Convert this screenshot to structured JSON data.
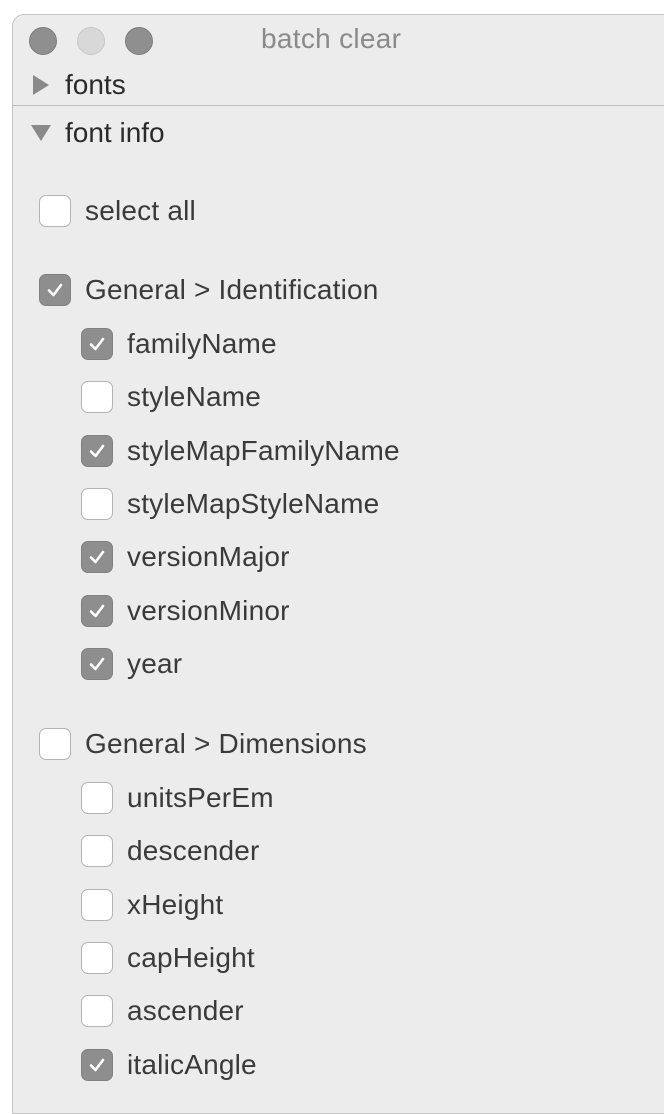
{
  "window": {
    "title": "batch clear"
  },
  "sections": {
    "fonts": {
      "label": "fonts",
      "expanded": false
    },
    "font_info": {
      "label": "font info",
      "expanded": true
    }
  },
  "select_all": {
    "label": "select all",
    "checked": false
  },
  "groups": [
    {
      "label": "General > Identification",
      "checked": true,
      "items": [
        {
          "label": "familyName",
          "checked": true
        },
        {
          "label": "styleName",
          "checked": false
        },
        {
          "label": "styleMapFamilyName",
          "checked": true
        },
        {
          "label": "styleMapStyleName",
          "checked": false
        },
        {
          "label": "versionMajor",
          "checked": true
        },
        {
          "label": "versionMinor",
          "checked": true
        },
        {
          "label": "year",
          "checked": true
        }
      ]
    },
    {
      "label": "General > Dimensions",
      "checked": false,
      "items": [
        {
          "label": "unitsPerEm",
          "checked": false
        },
        {
          "label": "descender",
          "checked": false
        },
        {
          "label": "xHeight",
          "checked": false
        },
        {
          "label": "capHeight",
          "checked": false
        },
        {
          "label": "ascender",
          "checked": false
        },
        {
          "label": "italicAngle",
          "checked": true
        }
      ]
    }
  ],
  "colors": {
    "window_bg": "#ececec",
    "checkbox_checked": "#8e8e8e",
    "text": "#3a3a3a"
  },
  "icons": {
    "collapsed": "triangle-right-icon",
    "expanded": "triangle-down-icon",
    "check": "checkmark-icon"
  }
}
